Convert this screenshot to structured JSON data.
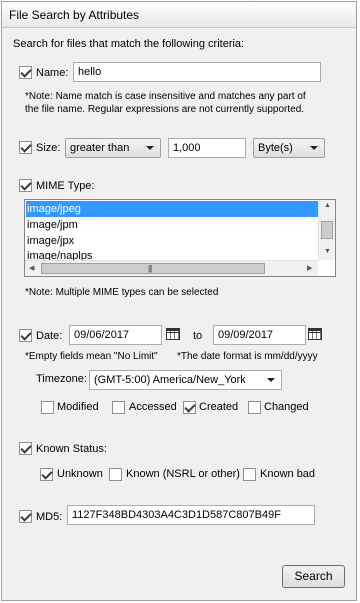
{
  "window": {
    "title": "File Search by Attributes"
  },
  "intro": "Search for files that match the following criteria:",
  "name": {
    "checked": true,
    "label": "Name:",
    "value": "hello",
    "note_line1": "*Note: Name match is case insensitive and matches any part of",
    "note_line2": "the file name. Regular expressions are not currently supported."
  },
  "size": {
    "checked": true,
    "label": "Size:",
    "comparator": "greater than",
    "value": "1,000",
    "unit": "Byte(s)"
  },
  "mime": {
    "checked": true,
    "label": "MIME Type:",
    "items": [
      "image/jpeg",
      "image/jpm",
      "image/jpx",
      "image/naplps"
    ],
    "selected_index": 0,
    "note": "*Note: Multiple MIME types can be selected"
  },
  "date": {
    "checked": true,
    "label": "Date:",
    "from": "09/06/2017",
    "to_label": "to",
    "to": "09/09/2017",
    "note_empty": "*Empty fields mean \"No Limit\"",
    "note_format": "*The date format is mm/dd/yyyy",
    "timezone_label": "Timezone:",
    "timezone_value": "(GMT-5:00) America/New_York",
    "options": [
      {
        "label": "Modified",
        "checked": false
      },
      {
        "label": "Accessed",
        "checked": false
      },
      {
        "label": "Created",
        "checked": true
      },
      {
        "label": "Changed",
        "checked": false
      }
    ]
  },
  "known_status": {
    "checked": true,
    "label": "Known Status:",
    "options": [
      {
        "label": "Unknown",
        "checked": true
      },
      {
        "label": "Known (NSRL or other)",
        "checked": false
      },
      {
        "label": "Known bad",
        "checked": false
      }
    ]
  },
  "md5": {
    "checked": true,
    "label": "MD5:",
    "value": "1127F348BD4303A4C3D1D587C807B49F"
  },
  "actions": {
    "search_label": "Search"
  }
}
